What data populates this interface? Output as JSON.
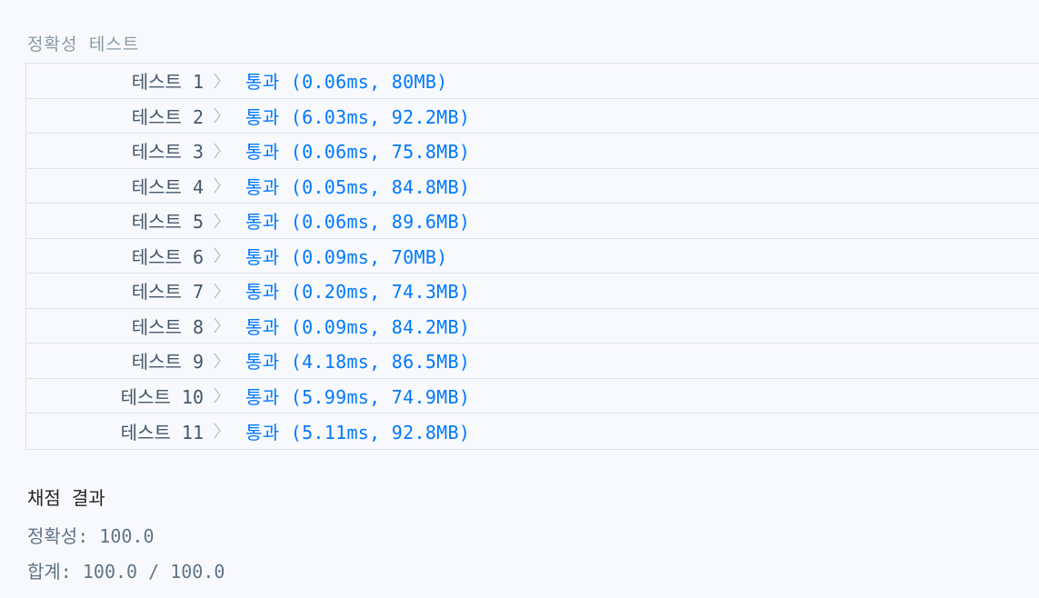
{
  "section": {
    "title": "정확성  테스트"
  },
  "tests": [
    {
      "label": "테스트 1",
      "result": "통과 (0.06ms, 80MB)"
    },
    {
      "label": "테스트 2",
      "result": "통과 (6.03ms, 92.2MB)"
    },
    {
      "label": "테스트 3",
      "result": "통과 (0.06ms, 75.8MB)"
    },
    {
      "label": "테스트 4",
      "result": "통과 (0.05ms, 84.8MB)"
    },
    {
      "label": "테스트 5",
      "result": "통과 (0.06ms, 89.6MB)"
    },
    {
      "label": "테스트 6",
      "result": "통과 (0.09ms, 70MB)"
    },
    {
      "label": "테스트 7",
      "result": "통과 (0.20ms, 74.3MB)"
    },
    {
      "label": "테스트 8",
      "result": "통과 (0.09ms, 84.2MB)"
    },
    {
      "label": "테스트 9",
      "result": "통과 (4.18ms, 86.5MB)"
    },
    {
      "label": "테스트 10",
      "result": "통과 (5.99ms, 74.9MB)"
    },
    {
      "label": "테스트 11",
      "result": "통과 (5.11ms, 92.8MB)"
    }
  ],
  "summary": {
    "title": "채점 결과",
    "accuracy": "정확성: 100.0",
    "total": "합계: 100.0 / 100.0"
  },
  "colors": {
    "pass": "#0078ff",
    "label": "#44576c",
    "muted": "#8a9aa8"
  }
}
